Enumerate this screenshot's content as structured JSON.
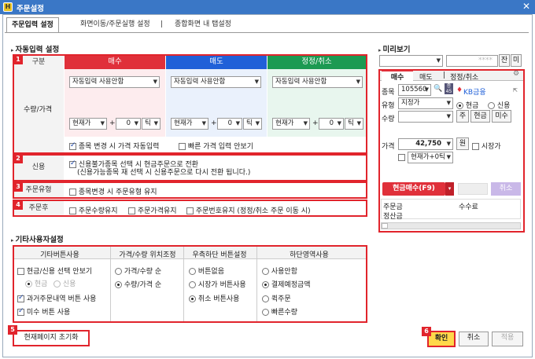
{
  "window": {
    "title": "주문설정",
    "close": "✕"
  },
  "tabs": [
    {
      "label": "주문입력 설정"
    },
    {
      "label": "화면이동/주문실행 설정"
    },
    {
      "label": "|"
    },
    {
      "label": "종합화면 내 탭설정"
    }
  ],
  "auto": {
    "title": "자동입력 설정",
    "headers": {
      "col0": "구분",
      "buy": "매수",
      "sell": "매도",
      "mod": "정정/취소"
    },
    "row_qty": "수량/가격",
    "select_default": "자동입력 사용안함",
    "price_select": "현재가",
    "plus": "+",
    "tick_value": "0",
    "tick": "틱",
    "opt1": "종목 변경 시 가격 자동입력",
    "opt2": "빠른 가격 입력 안보기",
    "credit_label": "신용",
    "credit_text1": "신용불가종목 선택 시 현금주문으로 전환",
    "credit_text2": "(신용가능종목 재 선택 시 신용주문으로 다시 전환 됩니다.)",
    "ordertype_label": "주문유형",
    "ordertype_text": "종목변경 시 주문유형 유지",
    "after_label": "주문후",
    "after1": "주문수량유지",
    "after2": "주문가격유지",
    "after3": "주문번호유지 (정정/취소 주문 이동 시)"
  },
  "badges": [
    "1",
    "2",
    "3",
    "4",
    "5",
    "6"
  ],
  "etc": {
    "title": "기타사용자설정",
    "col1": "기타버튼사용",
    "col2": "가격/수량 위치조정",
    "col3": "우측하단 버튼설정",
    "col4": "하단영역사용",
    "c1": [
      "현금/신용 선택 안보기",
      "현금",
      "신용",
      "과거주문내역 버튼 사용",
      "미수 버튼 사용"
    ],
    "c2": [
      "가격/수량 순",
      "수량/가격 순"
    ],
    "c3": [
      "버튼없음",
      "시장가 버튼사용",
      "취소 버튼사용"
    ],
    "c4": [
      "사용안함",
      "결제예정금액",
      "퀵주문",
      "빠른수량"
    ]
  },
  "reset_button": "현재페이지 초기화",
  "footer": {
    "ok": "확인",
    "cancel": "취소",
    "apply": "적용"
  },
  "preview": {
    "title": "미리보기",
    "stars": "****",
    "btn_jan": "잔",
    "btn_mi": "미",
    "tabs": [
      "매수",
      "매도",
      "|",
      "정정/취소"
    ],
    "stock_label": "종목",
    "stock_code": "105560",
    "stock_name": "KB금융",
    "type_label": "유형",
    "type_value": "지정가",
    "cash": "현금",
    "credit": "신용",
    "qty_label": "수량",
    "qty_btns": [
      "주",
      "현금",
      "미수"
    ],
    "price_label": "가격",
    "price_value": "42,750",
    "won": "원",
    "market": "시장가",
    "price_sel": "현재가+0틱",
    "buy_btn": "현금매수(F9)",
    "cancel_btn": "취소",
    "order_amt": "주문금",
    "fee": "수수료",
    "settle": "정산금"
  },
  "colors": {
    "buy": "#e0303a",
    "sell": "#2060d8",
    "mod": "#1c9a52",
    "red": "#e1242c"
  }
}
